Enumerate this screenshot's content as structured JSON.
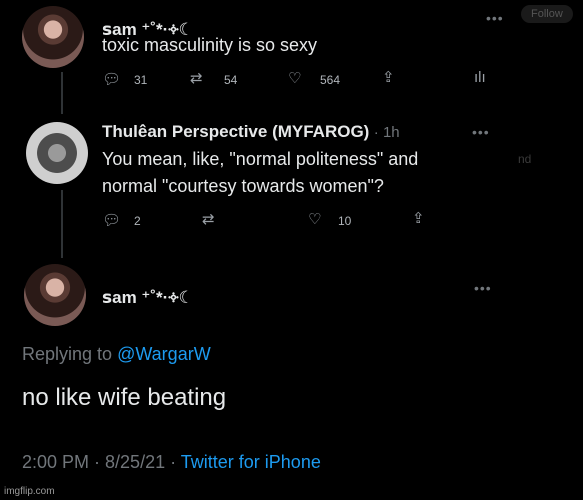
{
  "tweet1": {
    "name": "ꜱam ⁺˚*·༓☾",
    "text": "toxic masculinity is so sexy",
    "replies": "31",
    "retweets": "54",
    "likes": "564"
  },
  "tweet2": {
    "name": "Thulêan Perspective (MYFAROG)",
    "time": "· 1h",
    "text_line1": "You mean, like, \"normal politeness\" and",
    "text_line2": "normal \"courtesy towards women\"?",
    "replies": "2",
    "likes": "10"
  },
  "tweet3": {
    "name": "ꜱam ⁺˚*·༓☾",
    "replying_prefix": "Replying to",
    "replying_handle": "@WargarW",
    "text": "no like wife beating",
    "timestamp": "2:00 PM · 8/25/21 ·",
    "source": "Twitter for iPhone"
  },
  "background": {
    "follow_label": "Follow",
    "side_text": "nd"
  },
  "watermark": "imgflip.com",
  "icons": {
    "reply": "reply-icon",
    "retweet": "retweet-icon",
    "like": "heart-icon",
    "share": "share-icon",
    "analytics": "analytics-icon",
    "more": "more-icon"
  }
}
